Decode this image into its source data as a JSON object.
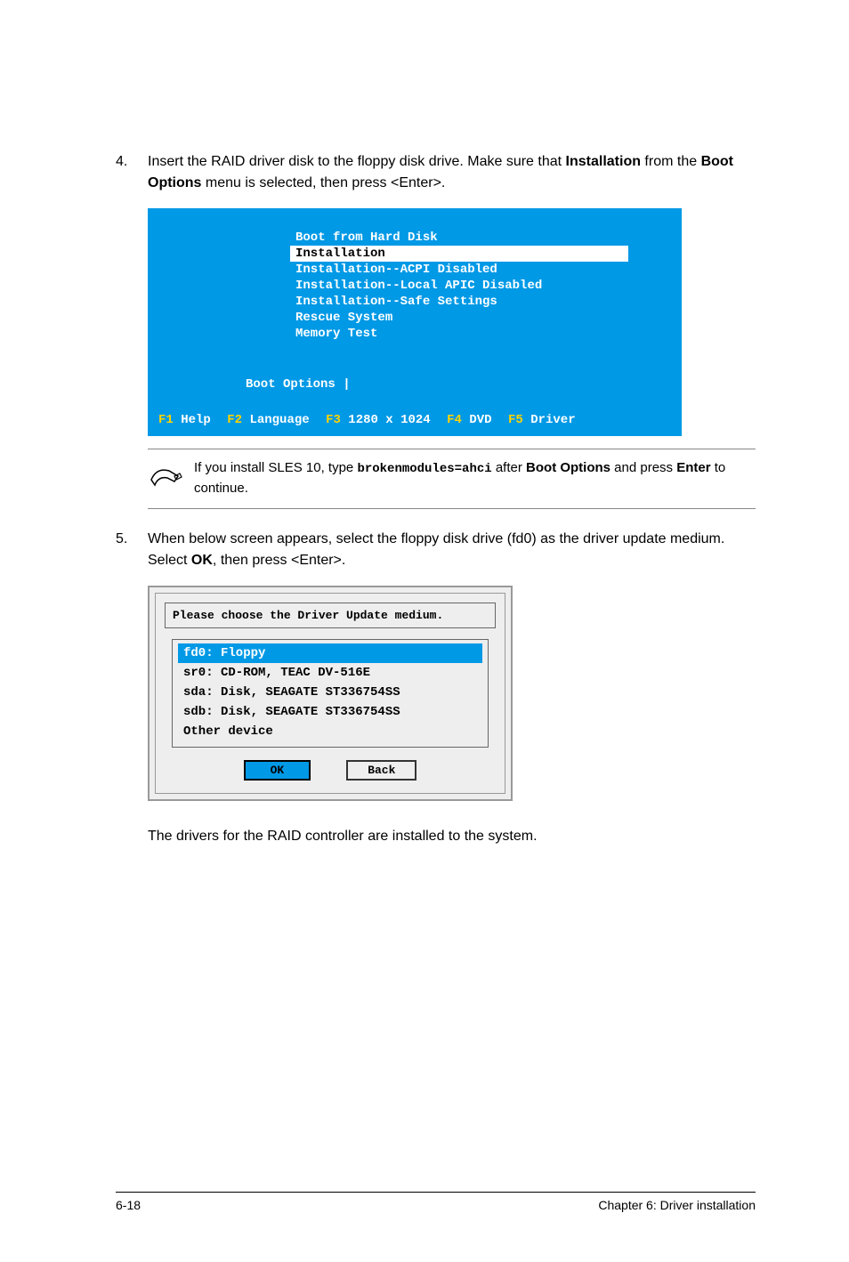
{
  "steps": {
    "s4": {
      "num": "4.",
      "text_pre": "Insert the RAID driver disk to the floppy disk drive. Make sure that ",
      "bold1": "Installation",
      "text_mid": " from the ",
      "bold2": "Boot Options",
      "text_post": " menu is selected, then press <Enter>."
    },
    "s5": {
      "num": "5.",
      "text_pre": "When below screen appears, select the floppy disk drive (fd0) as the driver update medium. Select ",
      "bold1": "OK",
      "text_post": ", then press <Enter>."
    }
  },
  "boot_menu": {
    "items": [
      "Boot from Hard Disk",
      "Installation",
      "Installation--ACPI Disabled",
      "Installation--Local APIC Disabled",
      "Installation--Safe Settings",
      "Rescue System",
      "Memory Test"
    ],
    "boot_options_label": "Boot Options |",
    "fkeys": {
      "f1k": "F1",
      "f1l": "Help",
      "f2k": "F2",
      "f2l": "Language",
      "f3k": "F3",
      "f3l": "1280 x 1024",
      "f4k": "F4",
      "f4l": "DVD",
      "f5k": "F5",
      "f5l": "Driver"
    }
  },
  "note": {
    "text_pre": "If you install SLES 10, type ",
    "code": "brokenmodules=ahci",
    "text_mid": " after ",
    "bold1": "Boot Options",
    "text_mid2": " and press ",
    "bold2": "Enter",
    "text_post": " to continue."
  },
  "dialog": {
    "header": "Please choose the Driver Update medium.",
    "items": [
      "fd0: Floppy",
      "sr0: CD-ROM, TEAC DV-516E",
      "sda: Disk, SEAGATE ST336754SS",
      "sdb: Disk, SEAGATE ST336754SS",
      "Other device"
    ],
    "buttons": {
      "ok": "OK",
      "back": "Back"
    }
  },
  "closing": "The drivers for the RAID controller are installed to the system.",
  "footer": {
    "left": "6-18",
    "right": "Chapter 6: Driver installation"
  }
}
